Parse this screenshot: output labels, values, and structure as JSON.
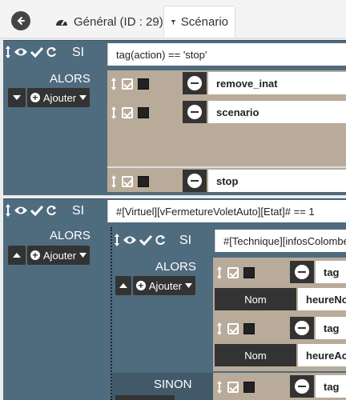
{
  "tabs": {
    "general": "Général (ID : 29)",
    "scenario": "Scénario"
  },
  "block1": {
    "si": "SI",
    "condition": "tag(action) == 'stop'",
    "alors": "ALORS",
    "add_label": "Ajouter",
    "actions": [
      {
        "name": "remove_inat"
      },
      {
        "name": "scenario"
      },
      {
        "name": "stop"
      }
    ]
  },
  "block2": {
    "si": "SI",
    "condition": "#[Virtuel][vFermetureVoletAuto][Etat]# == 1",
    "alors": "ALORS",
    "add_label": "Ajouter",
    "nested": {
      "si": "SI",
      "condition": "#[Technique][infosColombes",
      "alors": "ALORS",
      "add_label": "Ajouter",
      "sinon": "SINON",
      "actions": [
        {
          "name": "tag",
          "option_label": "Nom",
          "option_value": "heureNot"
        },
        {
          "name": "tag",
          "option_label": "Nom",
          "option_value": "heureActi"
        },
        {
          "name": "tag"
        }
      ]
    }
  },
  "colors": {
    "block_bg": "#4f6b7e",
    "action_bg": "#b8ab9a",
    "button_dark": "#333333"
  }
}
